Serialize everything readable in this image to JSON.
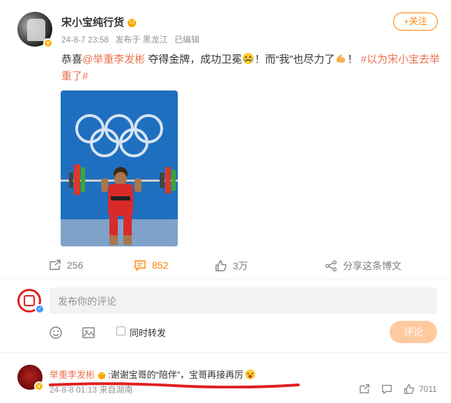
{
  "post": {
    "author": "宋小宝纯行货",
    "date": "24-8-7 23:58",
    "source": "发布于 黑龙江",
    "edited": "已编辑",
    "follow_label": "+关注",
    "text_intro": "恭喜",
    "mention": "@举重李发彬",
    "text_mid": " 夺得金牌，成功卫冕",
    "text_mid2": "！而“我”也尽力了",
    "text_end": "！",
    "hashtag": "#以为宋小宝去举重了#"
  },
  "actions": {
    "share_count": "256",
    "comment_count": "852",
    "like_count": "3万",
    "share_image_label": "分享这条博文"
  },
  "composer": {
    "placeholder": "发布你的评论",
    "repost_label": "同时转发",
    "submit_label": "评论"
  },
  "comment": {
    "author": "举重李发彬",
    "text": ":谢谢宝哥的“陪伴”，宝哥再接再厉",
    "date": "24-8-8 01:13",
    "source": "来自湖南",
    "like_count": "7011"
  },
  "colors": {
    "brand_orange": "#ff8200",
    "link": "#eb7350",
    "submit_disabled": "#ffc99e"
  }
}
